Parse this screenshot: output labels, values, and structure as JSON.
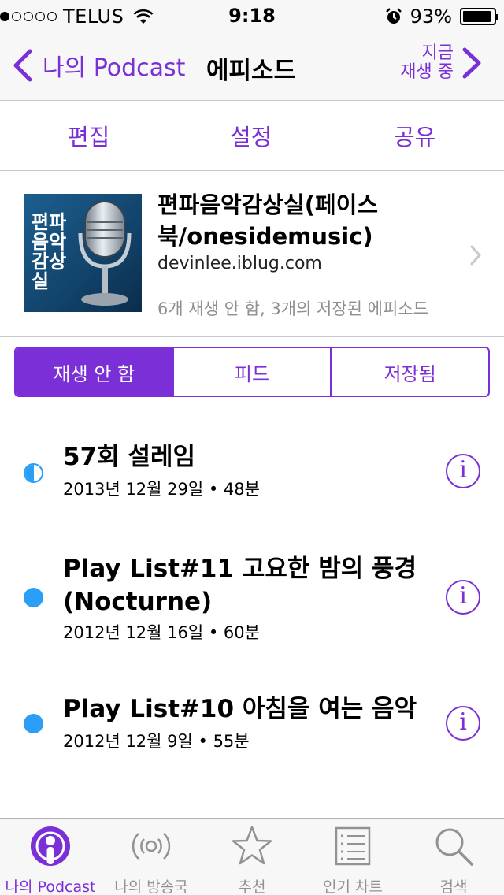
{
  "status_bar": {
    "carrier": "TELUS",
    "signal_bars": 1,
    "time": "9:18",
    "battery_percent": "93%",
    "battery_level": 0.93
  },
  "nav": {
    "back_label": "나의 Podcast",
    "title": "에피소드",
    "now_playing_line1": "지금",
    "now_playing_line2": "재생 중"
  },
  "actions": {
    "edit": "편집",
    "settings": "설정",
    "share": "공유"
  },
  "podcast": {
    "artwork_text": "편파음악감상실",
    "title": "편파음악감상실(페이스북/onesidemusic)",
    "url": "devinlee.iblug.com",
    "meta": "6개 재생 안 함, 3개의 저장된 에피소드"
  },
  "segments": [
    {
      "label": "재생 안 함",
      "active": true
    },
    {
      "label": "피드",
      "active": false
    },
    {
      "label": "저장됨",
      "active": false
    }
  ],
  "episodes": [
    {
      "title": "57회 설레임",
      "date": "2013년 12월 29일 • 48분",
      "status": "partial"
    },
    {
      "title": "Play List#11 고요한 밤의 풍경 (Nocturne)",
      "date": "2012년 12월 16일 • 60분",
      "status": "unplayed"
    },
    {
      "title": "Play List#10 아침을 여는 음악",
      "date": "2012년 12월 9일 • 55분",
      "status": "unplayed"
    }
  ],
  "info_glyph": "i",
  "tabs": [
    {
      "label": "나의 Podcast",
      "icon": "podcast-icon",
      "active": true
    },
    {
      "label": "나의 방송국",
      "icon": "broadcast-icon",
      "active": false
    },
    {
      "label": "추천",
      "icon": "star-icon",
      "active": false
    },
    {
      "label": "인기 차트",
      "icon": "chart-list-icon",
      "active": false
    },
    {
      "label": "검색",
      "icon": "search-icon",
      "active": false
    }
  ],
  "colors": {
    "accent": "#7b2fd6",
    "unplayed_dot": "#2b9ff6",
    "separator": "#c8c7cc"
  }
}
